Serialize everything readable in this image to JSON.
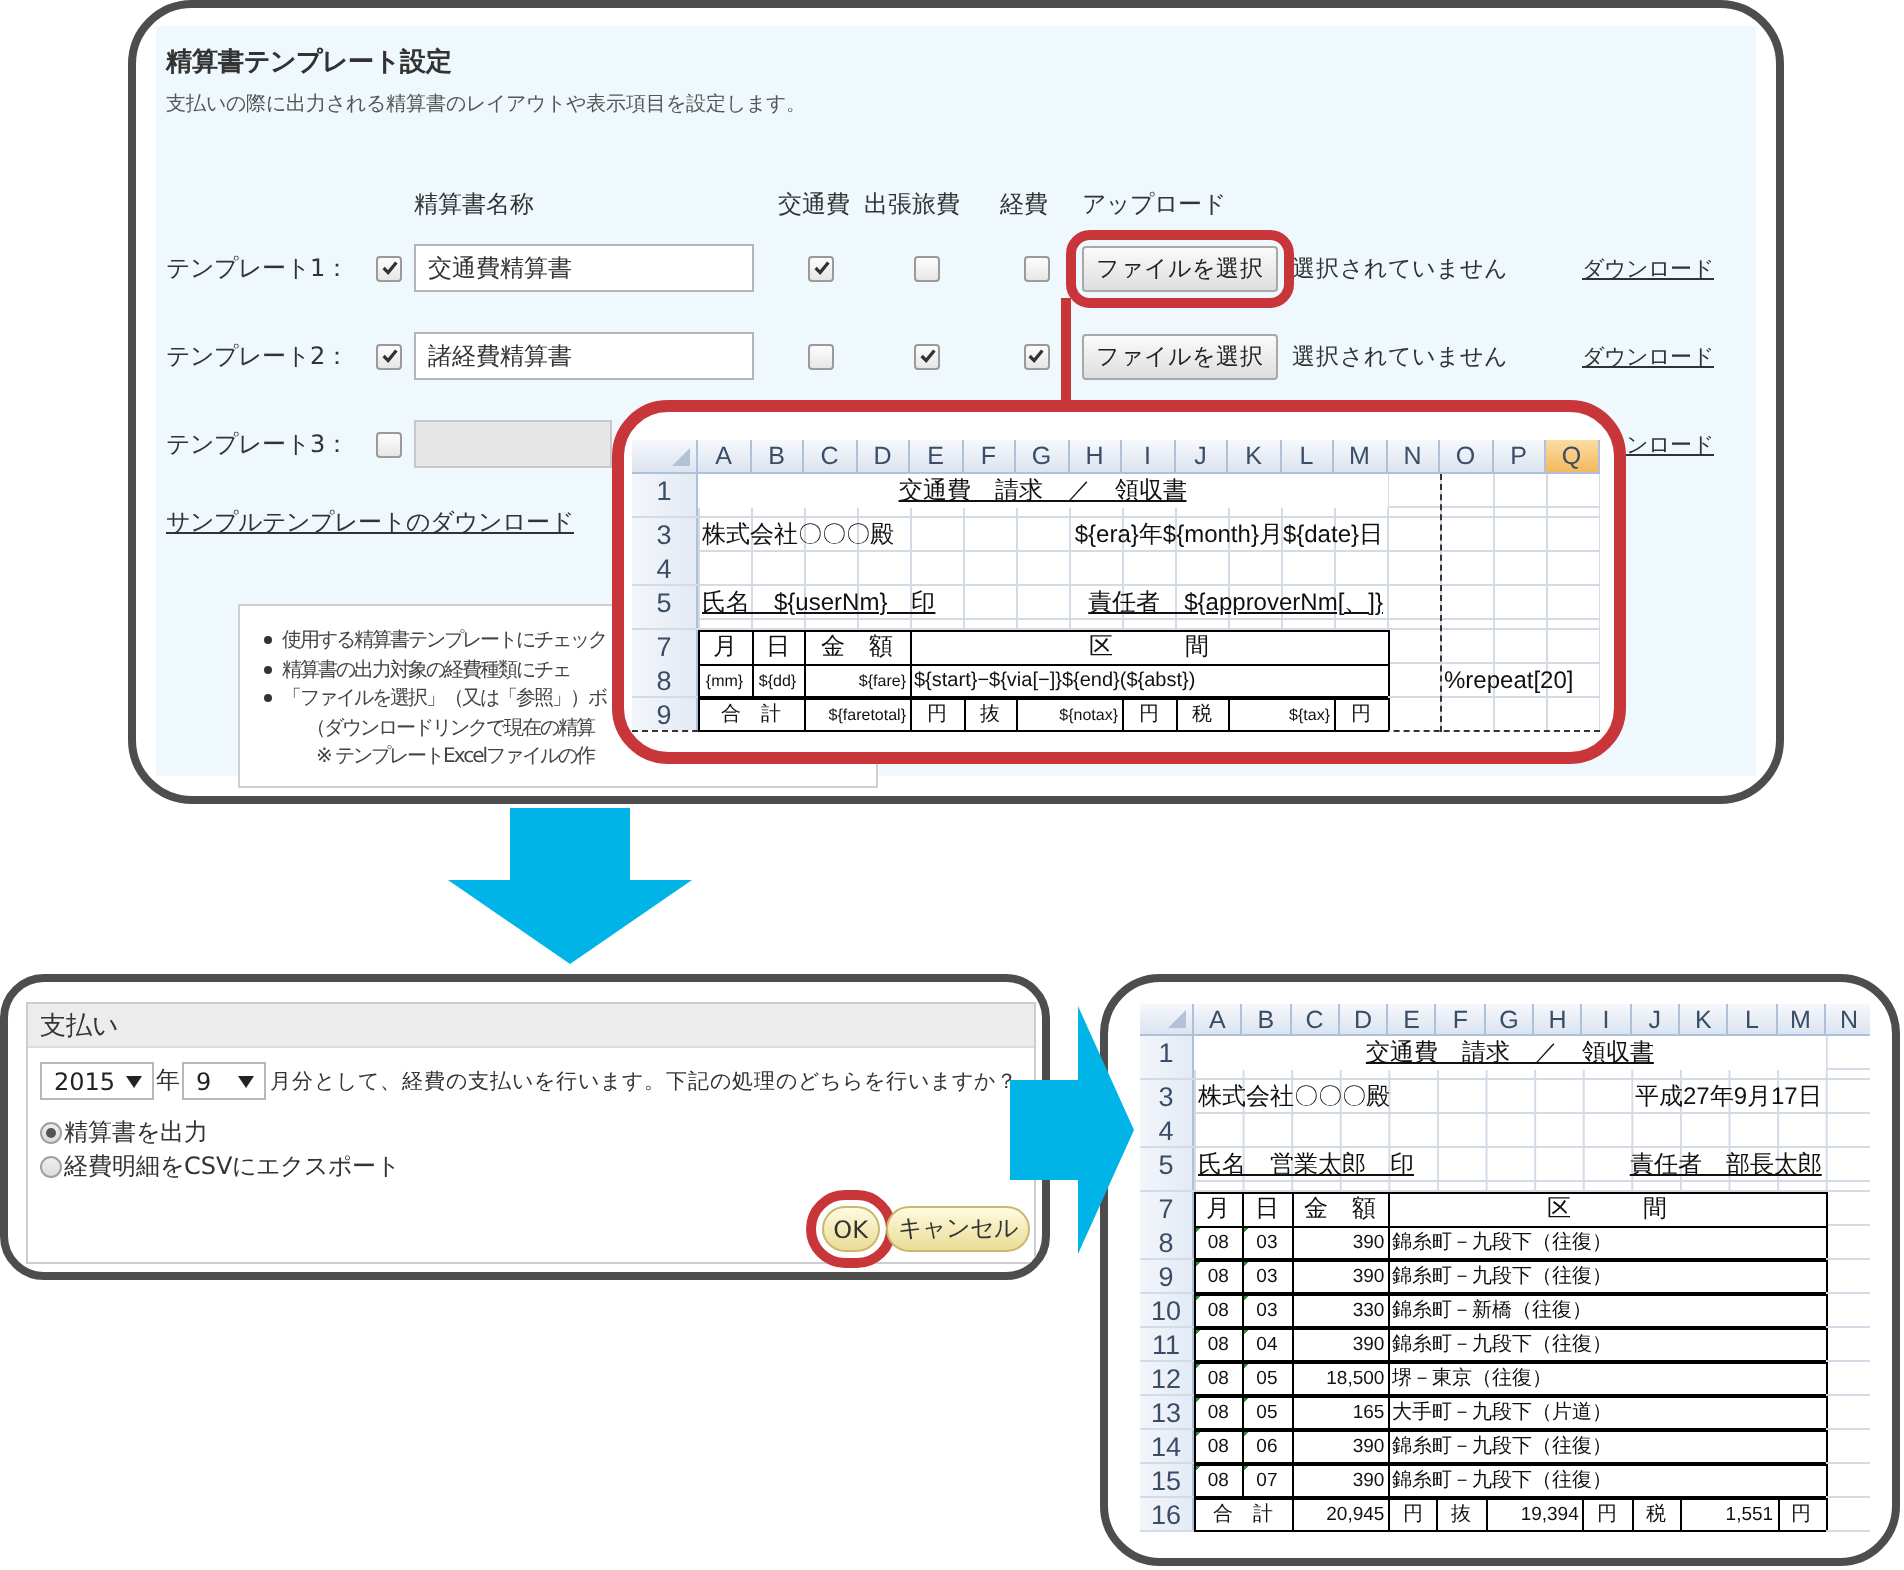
{
  "settings_panel": {
    "title": "精算書テンプレート設定",
    "description": "支払いの際に出力される精算書のレイアウトや表示項目を設定します。",
    "columns": [
      "精算書名称",
      "交通費",
      "出張旅費",
      "経費",
      "アップロード"
    ],
    "templates": [
      {
        "label": "テンプレート1：",
        "enabled": true,
        "name": "交通費精算書",
        "disabled": false,
        "expense_types": [
          {
            "checked": true
          },
          {
            "checked": false
          },
          {
            "checked": false
          }
        ],
        "upload_button": "ファイルを選択",
        "file_status": "選択されていません",
        "highlighted": true,
        "download": "ダウンロード"
      },
      {
        "label": "テンプレート2：",
        "enabled": true,
        "name": "諸経費精算書",
        "disabled": false,
        "expense_types": [
          {
            "checked": false
          },
          {
            "checked": true
          },
          {
            "checked": true
          }
        ],
        "upload_button": "ファイルを選択",
        "file_status": "選択されていません",
        "highlighted": false,
        "download": "ダウンロード"
      },
      {
        "label": "テンプレート3：",
        "enabled": false,
        "disabled": true,
        "download": "ンロード"
      }
    ],
    "sample_link": "サンプルテンプレートのダウンロード",
    "notes": [
      {
        "kind": "bullet",
        "text": "使用する精算書テンプレートにチェック"
      },
      {
        "kind": "bullet",
        "text": "精算書の出力対象の経費種類にチェ"
      },
      {
        "kind": "bullet",
        "text": "「ファイルを選択」（又は「参照」）ボ"
      },
      {
        "kind": "continuation",
        "text": "（ダウンロードリンクで現在の精算"
      },
      {
        "kind": "remark",
        "text": "※ テンプレートExcelファイルの作"
      }
    ]
  },
  "template_preview": {
    "columns": [
      {
        "label": "A",
        "selected": false
      },
      {
        "label": "B",
        "selected": false
      },
      {
        "label": "C",
        "selected": false
      },
      {
        "label": "D",
        "selected": false
      },
      {
        "label": "E",
        "selected": false
      },
      {
        "label": "F",
        "selected": false
      },
      {
        "label": "G",
        "selected": false
      },
      {
        "label": "H",
        "selected": false
      },
      {
        "label": "I",
        "selected": false
      },
      {
        "label": "J",
        "selected": false
      },
      {
        "label": "K",
        "selected": false
      },
      {
        "label": "L",
        "selected": false
      },
      {
        "label": "M",
        "selected": false
      },
      {
        "label": "N",
        "selected": false
      },
      {
        "label": "O",
        "selected": false
      },
      {
        "label": "P",
        "selected": false
      },
      {
        "label": "Q",
        "selected": true
      }
    ],
    "rows": [
      {
        "number": "1",
        "kind": "title",
        "texts": [
          "交通費　請求　／　領収書"
        ]
      },
      {
        "kind": "thin"
      },
      {
        "number": "3",
        "kind": "address",
        "texts": [
          "株式会社〇〇〇殿",
          "${era}年${month}月${date}日"
        ]
      },
      {
        "number": "4",
        "kind": "empty"
      },
      {
        "number": "5",
        "kind": "names",
        "texts": [
          "氏名　${userNm}　印",
          "責任者　${approverNm[、]}"
        ]
      },
      {
        "kind": "thin"
      },
      {
        "number": "7",
        "kind": "table-head",
        "texts": [
          "月",
          "日",
          "金　額",
          "区　　　間"
        ]
      },
      {
        "number": "8",
        "kind": "table-row",
        "texts": [
          "{mm}",
          "${dd}",
          "${fare}",
          "${start}−${via[−]}${end}(${abst})"
        ],
        "note": "%repeat[20]"
      },
      {
        "number": "9",
        "kind": "total",
        "texts": [
          "合　計",
          "${faretotal}",
          "円",
          "抜",
          "${notax}",
          "円",
          "税",
          "${tax}",
          "円"
        ]
      }
    ]
  },
  "payment_dialog": {
    "title": "支払い",
    "year": "2015",
    "year_unit": "年",
    "month": "9",
    "prompt": "月分として、経費の支払いを行います。下記の処理のどちらを行いますか？",
    "options": [
      {
        "label": "精算書を出力",
        "selected": true
      },
      {
        "label": "経費明細をCSVにエクスポート",
        "selected": false
      }
    ],
    "buttons": [
      {
        "label": "OK",
        "highlighted": true
      },
      {
        "label": "キャンセル",
        "highlighted": false
      }
    ]
  },
  "output_preview": {
    "columns": [
      {
        "label": "A",
        "selected": false
      },
      {
        "label": "B",
        "selected": false
      },
      {
        "label": "C",
        "selected": false
      },
      {
        "label": "D",
        "selected": false
      },
      {
        "label": "E",
        "selected": false
      },
      {
        "label": "F",
        "selected": false
      },
      {
        "label": "G",
        "selected": false
      },
      {
        "label": "H",
        "selected": false
      },
      {
        "label": "I",
        "selected": false
      },
      {
        "label": "J",
        "selected": false
      },
      {
        "label": "K",
        "selected": false
      },
      {
        "label": "L",
        "selected": false
      },
      {
        "label": "M",
        "selected": false
      },
      {
        "label": "N",
        "selected": false
      }
    ],
    "rows": [
      {
        "number": "1",
        "kind": "title",
        "texts": [
          "交通費　請求　／　領収書"
        ]
      },
      {
        "kind": "thin"
      },
      {
        "number": "3",
        "kind": "address",
        "texts": [
          "株式会社〇〇〇殿",
          "平成27年9月17日"
        ]
      },
      {
        "number": "4",
        "kind": "empty"
      },
      {
        "number": "5",
        "kind": "names",
        "texts": [
          "氏名　営業太郎　印",
          "責任者　部長太郎"
        ]
      },
      {
        "kind": "thin"
      },
      {
        "number": "7",
        "kind": "table-head",
        "texts": [
          "月",
          "日",
          "金　額",
          "区　　　間"
        ]
      },
      {
        "number": "8",
        "kind": "table-row",
        "texts": [
          "08",
          "03",
          "390",
          "錦糸町－九段下（往復）"
        ]
      },
      {
        "number": "9",
        "kind": "table-row",
        "texts": [
          "08",
          "03",
          "390",
          "錦糸町－九段下（往復）"
        ]
      },
      {
        "number": "10",
        "kind": "table-row",
        "texts": [
          "08",
          "03",
          "330",
          "錦糸町－新橋（往復）"
        ]
      },
      {
        "number": "11",
        "kind": "table-row",
        "texts": [
          "08",
          "04",
          "390",
          "錦糸町－九段下（往復）"
        ]
      },
      {
        "number": "12",
        "kind": "table-row",
        "texts": [
          "08",
          "05",
          "18,500",
          "堺－東京（往復）"
        ]
      },
      {
        "number": "13",
        "kind": "table-row",
        "texts": [
          "08",
          "05",
          "165",
          "大手町－九段下（片道）"
        ]
      },
      {
        "number": "14",
        "kind": "table-row",
        "texts": [
          "08",
          "06",
          "390",
          "錦糸町－九段下（往復）"
        ]
      },
      {
        "number": "15",
        "kind": "table-row",
        "texts": [
          "08",
          "07",
          "390",
          "錦糸町－九段下（往復）"
        ]
      },
      {
        "number": "16",
        "kind": "total",
        "texts": [
          "合　計",
          "20,945",
          "円",
          "抜",
          "19,394",
          "円",
          "税",
          "1,551",
          "円"
        ]
      }
    ]
  }
}
